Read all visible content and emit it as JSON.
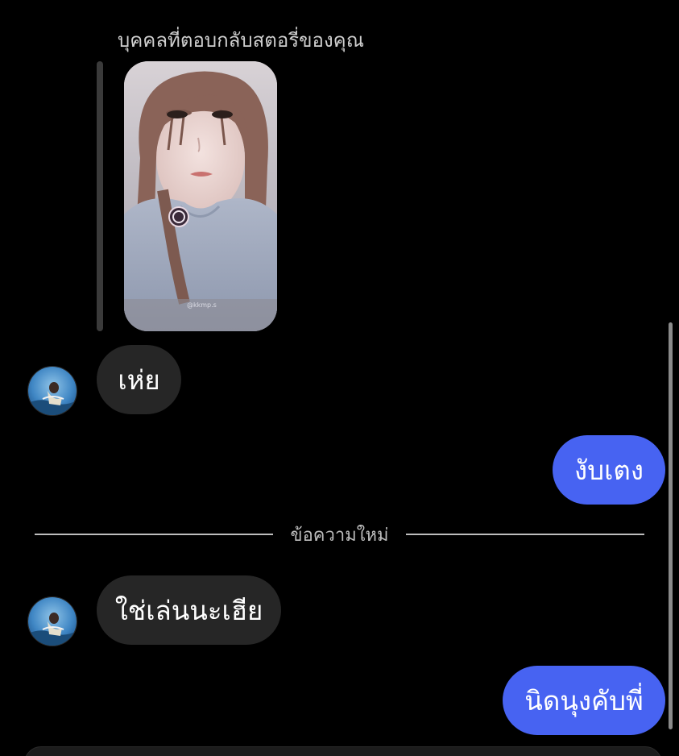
{
  "story_reply": {
    "caption": "บุคคลที่ตอบกลับสตอรี่ของคุณ",
    "thumbnail_watermark": "@kkmp.s"
  },
  "messages": [
    {
      "direction": "incoming",
      "text": "เห่ย"
    },
    {
      "direction": "outgoing",
      "text": "งับเตง"
    },
    {
      "direction": "incoming",
      "text": "ใช่เล่นนะเฮีย"
    },
    {
      "direction": "outgoing",
      "text": "นิดนุงคับพี่"
    }
  ],
  "divider": {
    "label": "ข้อความใหม่"
  },
  "colors": {
    "background": "#000000",
    "incoming_bubble": "#262626",
    "outgoing_bubble": "#4763f2",
    "text": "#ffffff",
    "muted_text": "#bdbdbd"
  },
  "icons": {
    "avatar": "contact-avatar"
  }
}
